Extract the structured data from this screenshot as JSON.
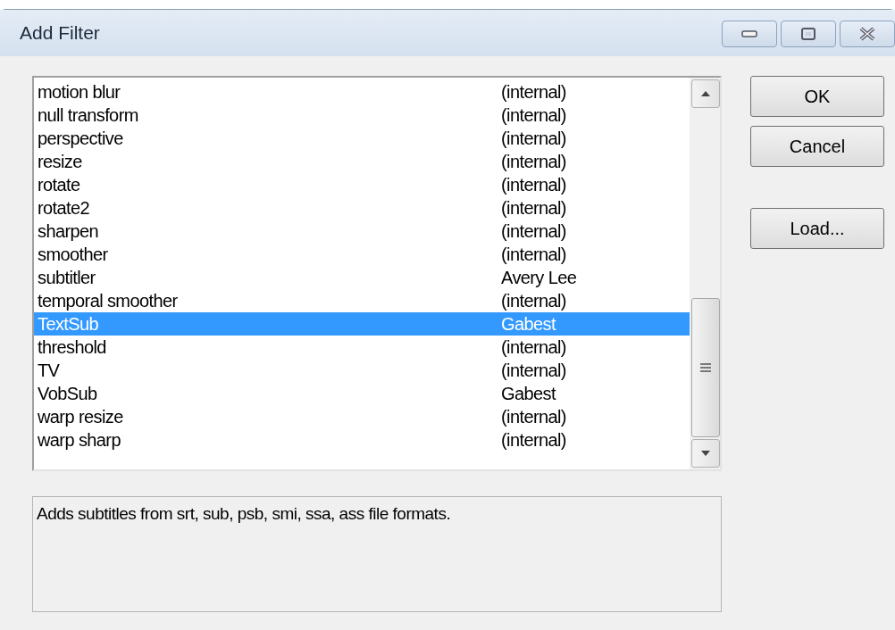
{
  "window": {
    "title": "Add Filter"
  },
  "filters": [
    {
      "name": "motion blur",
      "author": "(internal)",
      "selected": false
    },
    {
      "name": "null transform",
      "author": "(internal)",
      "selected": false
    },
    {
      "name": "perspective",
      "author": "(internal)",
      "selected": false
    },
    {
      "name": "resize",
      "author": "(internal)",
      "selected": false
    },
    {
      "name": "rotate",
      "author": "(internal)",
      "selected": false
    },
    {
      "name": "rotate2",
      "author": "(internal)",
      "selected": false
    },
    {
      "name": "sharpen",
      "author": "(internal)",
      "selected": false
    },
    {
      "name": "smoother",
      "author": "(internal)",
      "selected": false
    },
    {
      "name": "subtitler",
      "author": "Avery Lee",
      "selected": false
    },
    {
      "name": "temporal smoother",
      "author": "(internal)",
      "selected": false
    },
    {
      "name": "TextSub",
      "author": "Gabest",
      "selected": true
    },
    {
      "name": "threshold",
      "author": "(internal)",
      "selected": false
    },
    {
      "name": "TV",
      "author": "(internal)",
      "selected": false
    },
    {
      "name": "VobSub",
      "author": "Gabest",
      "selected": false
    },
    {
      "name": "warp resize",
      "author": "(internal)",
      "selected": false
    },
    {
      "name": "warp sharp",
      "author": "(internal)",
      "selected": false
    }
  ],
  "buttons": [
    "OK",
    "Cancel",
    "Load..."
  ],
  "description": "Adds subtitles from srt, sub, psb, smi, ssa, ass file formats."
}
